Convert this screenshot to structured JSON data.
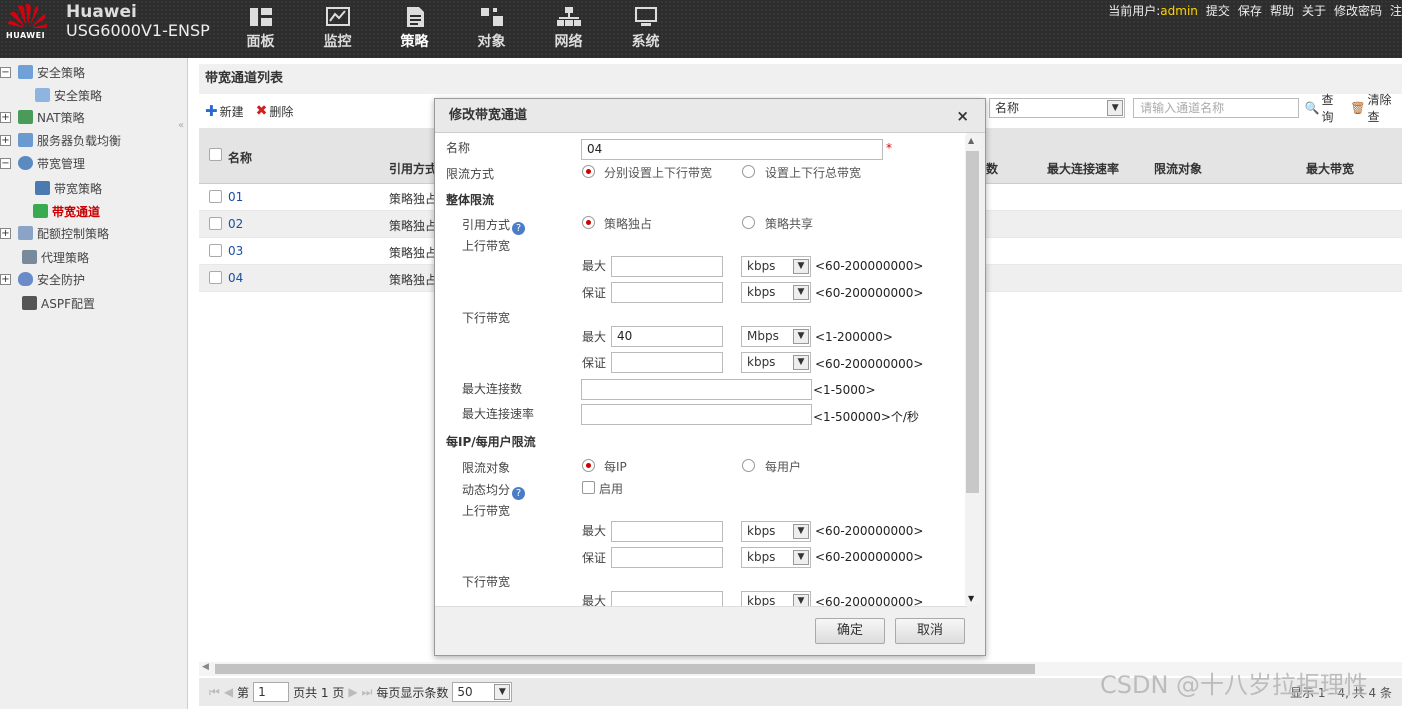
{
  "header": {
    "brand_top": "Huawei",
    "logo_text": "HUAWEI",
    "product": "USG6000V1-ENSP",
    "nav": [
      {
        "label": "面板",
        "icon": "dashboard-icon"
      },
      {
        "label": "监控",
        "icon": "monitor-icon"
      },
      {
        "label": "策略",
        "icon": "policy-icon"
      },
      {
        "label": "对象",
        "icon": "object-icon"
      },
      {
        "label": "网络",
        "icon": "network-icon"
      },
      {
        "label": "系统",
        "icon": "system-icon"
      }
    ],
    "current_user_label": "当前用户:",
    "user": "admin",
    "links": [
      "提交",
      "保存",
      "帮助",
      "关于",
      "修改密码",
      "注"
    ]
  },
  "sidebar": {
    "items": [
      "安全策略",
      "安全策略",
      "NAT策略",
      "服务器负载均衡",
      "带宽管理",
      "带宽策略",
      "带宽通道",
      "配额控制策略",
      "代理策略",
      "安全防护",
      "ASPF配置"
    ]
  },
  "breadcrumb": "带宽通道列表",
  "toolbar": {
    "new": "新建",
    "delete": "删除"
  },
  "filter": {
    "field": "名称",
    "placeholder": "请输入通道名称",
    "query": "查询",
    "clear": "清除查"
  },
  "table": {
    "headers": [
      "名称",
      "引用方式",
      "数",
      "最大连接速率",
      "限流对象",
      "最大带宽"
    ],
    "rows": [
      {
        "name": "01",
        "type": "策略独占"
      },
      {
        "name": "02",
        "type": "策略独占"
      },
      {
        "name": "03",
        "type": "策略独占"
      },
      {
        "name": "04",
        "type": "策略独占"
      }
    ]
  },
  "pager": {
    "page_prefix": "第",
    "page": "1",
    "page_suffix": "页共 1 页",
    "per_page_label": "每页显示条数",
    "per_page": "50",
    "summary": "显示 1 - 4, 共 4 条"
  },
  "watermark": "CSDN @十八岁拉拒理性",
  "dialog": {
    "title": "修改带宽通道",
    "close": "×",
    "name_label": "名称",
    "name_value": "04",
    "required": "*",
    "mode_label": "限流方式",
    "mode_opt1": "分别设置上下行带宽",
    "mode_opt2": "设置上下行总带宽",
    "overall": "整体限流",
    "ref_label": "引用方式",
    "ref_opt1": "策略独占",
    "ref_opt2": "策略共享",
    "up_label": "上行带宽",
    "down_label": "下行带宽",
    "max": "最大",
    "guarantee": "保证",
    "up_max_unit": "kbps",
    "up_max_hint": "<60-200000000>",
    "up_g_unit": "kbps",
    "up_g_hint": "<60-200000000>",
    "down_max_value": "40",
    "down_max_unit": "Mbps",
    "down_max_hint": "<1-200000>",
    "down_g_unit": "kbps",
    "down_g_hint": "<60-200000000>",
    "max_conn_label": "最大连接数",
    "max_conn_hint": "<1-5000>",
    "max_rate_label": "最大连接速率",
    "max_rate_hint": "<1-500000>个/秒",
    "perip": "每IP/每用户限流",
    "target_label": "限流对象",
    "target_opt1": "每IP",
    "target_opt2": "每用户",
    "dyn_label": "动态均分",
    "dyn_opt": "启用",
    "p_up_max_unit": "kbps",
    "p_up_max_hint": "<60-200000000>",
    "p_up_g_unit": "kbps",
    "p_up_g_hint": "<60-200000000>",
    "p_down_max_unit": "kbps",
    "p_down_max_hint": "<60-200000000>",
    "ok": "确定",
    "cancel": "取消"
  }
}
